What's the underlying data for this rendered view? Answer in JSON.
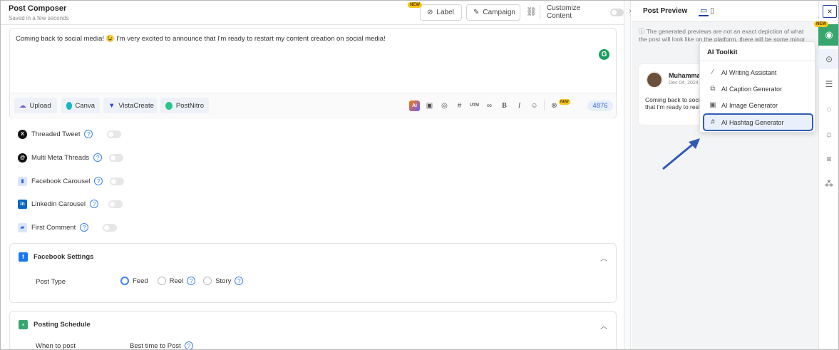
{
  "composer": {
    "title": "Post Composer",
    "subtitle": "Saved in a few seconds",
    "new_badge": "NEW",
    "label_button": "Label",
    "campaign_button": "Campaign",
    "customize_label": "Customize Content",
    "editor_text": "Coming back to social media! 😉 I'm very excited to announce that I'm ready to restart my content creation on social media!",
    "toolbar": {
      "upload": "Upload",
      "canva": "Canva",
      "vistacreate": "VistaCreate",
      "postnitro": "PostNitro",
      "ai_icon": "Ai",
      "utm": "UTM",
      "bold": "B",
      "italic": "I",
      "new_badge": "NEW",
      "char_count": "4876"
    },
    "options": [
      {
        "label": "Threaded Tweet"
      },
      {
        "label": "Multi Meta Threads"
      },
      {
        "label": "Facebook Carousel"
      },
      {
        "label": "Linkedin Carousel"
      },
      {
        "label": "First Comment"
      }
    ],
    "facebook_settings": {
      "title": "Facebook Settings",
      "post_type_label": "Post Type",
      "types": [
        "Feed",
        "Reel",
        "Story"
      ],
      "selected": "Feed"
    },
    "posting_schedule": {
      "title": "Posting Schedule",
      "when_label": "When to post",
      "best_time_label": "Best time to Post"
    }
  },
  "preview": {
    "title": "Post Preview",
    "note": "The generated previews are not an exact depiction of what the post will look like on the platform, there will be some minor",
    "card": {
      "name": "Muhammad",
      "date": "Dec 04, 2024",
      "text": "Coming back to social media! I'm very excited to announce that I'm ready to restart my content creation on social media!"
    }
  },
  "toolkit": {
    "title": "AI Toolkit",
    "items": [
      {
        "label": "AI Writing Assistant",
        "icon": "magic-wand-icon"
      },
      {
        "label": "AI Caption Generator",
        "icon": "caption-icon"
      },
      {
        "label": "AI Image Generator",
        "icon": "image-ai-icon"
      },
      {
        "label": "AI Hashtag Generator",
        "icon": "hashtag-icon"
      }
    ],
    "selected": "AI Hashtag Generator"
  },
  "rail": {
    "close": "×",
    "new_badge": "NEW"
  },
  "colors": {
    "accent": "#3b82f6",
    "highlight_border": "#2f5bb7",
    "bot_green": "#37a66e",
    "new_badge": "#f5c518"
  }
}
